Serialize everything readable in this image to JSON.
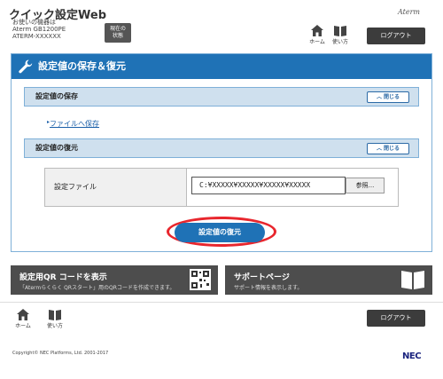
{
  "header": {
    "app_title": "クイック設定Web",
    "model_line1": "お使いの機器は",
    "model_line2": "Aterm GB1200PE",
    "model_line3": "ATERM-XXXXXX",
    "status_btn_line1": "現在の",
    "status_btn_line2": "状態",
    "brand": "Aterm",
    "home_label": "ホーム",
    "manual_label": "使い方",
    "logout_label": "ログアウト"
  },
  "panel": {
    "title": "設定値の保存＆復元",
    "save_section": {
      "title": "設定値の保存",
      "close_label": "閉じる",
      "link": "ファイルへ保存"
    },
    "restore_section": {
      "title": "設定値の復元",
      "close_label": "閉じる",
      "file_label": "設定ファイル",
      "file_value": "C:¥XXXXX¥XXXXX¥XXXXX¥XXXXX",
      "browse_label": "参照...",
      "restore_button": "設定値の復元"
    }
  },
  "tiles": {
    "qr": {
      "title": "設定用QR コードを表示",
      "desc": "「Atermらくらく QRスタート」用のQRコードを作成できます。"
    },
    "support": {
      "title": "サポートページ",
      "desc": "サポート情報を表示します。"
    }
  },
  "footer": {
    "home_label": "ホーム",
    "manual_label": "使い方",
    "logout_label": "ログアウト",
    "copyright": "Copyright© NEC Platforms, Ltd. 2001-2017",
    "logo": "NEC"
  },
  "colors": {
    "primary": "#1f72b6",
    "section_bg": "#cfe0ee",
    "highlight_ring": "#e8262d",
    "tile_bg": "#4d4d4d",
    "dark_button": "#3c3c3c"
  }
}
